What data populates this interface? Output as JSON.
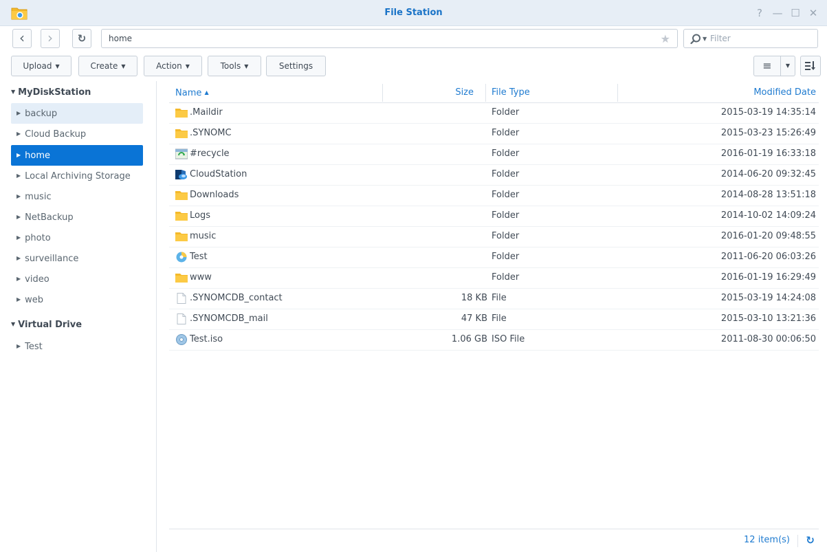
{
  "window": {
    "title": "File Station",
    "icons": {
      "app": "file-station-icon",
      "help": "help-icon",
      "minimize": "minimize-icon",
      "maximize": "maximize-icon",
      "close": "close-icon"
    },
    "accent": "#0a74d6"
  },
  "nav": {
    "back": "‹",
    "forward": "›",
    "refresh": "↻",
    "path": "home",
    "filter_placeholder": "Filter"
  },
  "toolbar": {
    "upload": "Upload",
    "create": "Create",
    "action": "Action",
    "tools": "Tools",
    "settings": "Settings"
  },
  "sidebar": {
    "roots": [
      {
        "label": "MyDiskStation"
      },
      {
        "label": "Virtual Drive"
      }
    ],
    "items": [
      {
        "label": "backup"
      },
      {
        "label": "Cloud Backup"
      },
      {
        "label": "home"
      },
      {
        "label": "Local Archiving Storage"
      },
      {
        "label": "music"
      },
      {
        "label": "NetBackup"
      },
      {
        "label": "photo"
      },
      {
        "label": "surveillance"
      },
      {
        "label": "video"
      },
      {
        "label": "web"
      },
      {
        "label": "Test"
      }
    ],
    "selected": "home",
    "hovered": "backup"
  },
  "list": {
    "columns": {
      "name": "Name",
      "size": "Size",
      "type": "File Type",
      "date": "Modified Date"
    },
    "sort": "name-ascending",
    "rows": [
      {
        "icon": "folder-icon",
        "name": ".Maildir",
        "size": "",
        "type": "Folder",
        "date": "2015-03-19 14:35:14"
      },
      {
        "icon": "folder-icon",
        "name": ".SYNOMC",
        "size": "",
        "type": "Folder",
        "date": "2015-03-23 15:26:49"
      },
      {
        "icon": "recycle-folder-icon",
        "name": "#recycle",
        "size": "",
        "type": "Folder",
        "date": "2016-01-19 16:33:18"
      },
      {
        "icon": "cloudstation-folder-icon",
        "name": "CloudStation",
        "size": "",
        "type": "Folder",
        "date": "2014-06-20 09:32:45"
      },
      {
        "icon": "folder-icon",
        "name": "Downloads",
        "size": "",
        "type": "Folder",
        "date": "2014-08-28 13:51:18"
      },
      {
        "icon": "folder-icon",
        "name": "Logs",
        "size": "",
        "type": "Folder",
        "date": "2014-10-02 14:09:24"
      },
      {
        "icon": "folder-icon",
        "name": "music",
        "size": "",
        "type": "Folder",
        "date": "2016-01-20 09:48:55"
      },
      {
        "icon": "virtual-drive-icon",
        "name": "Test",
        "size": "",
        "type": "Folder",
        "date": "2011-06-20 06:03:26"
      },
      {
        "icon": "folder-icon",
        "name": "www",
        "size": "",
        "type": "Folder",
        "date": "2016-01-19 16:29:49"
      },
      {
        "icon": "file-icon",
        "name": ".SYNOMCDB_contact",
        "size": "18 KB",
        "type": "File",
        "date": "2015-03-19 14:24:08"
      },
      {
        "icon": "file-icon",
        "name": ".SYNOMCDB_mail",
        "size": "47 KB",
        "type": "File",
        "date": "2015-03-10 13:21:36"
      },
      {
        "icon": "iso-disc-icon",
        "name": "Test.iso",
        "size": "1.06 GB",
        "type": "ISO File",
        "date": "2011-08-30 00:06:50"
      }
    ]
  },
  "status": {
    "count": "12 item(s)"
  }
}
